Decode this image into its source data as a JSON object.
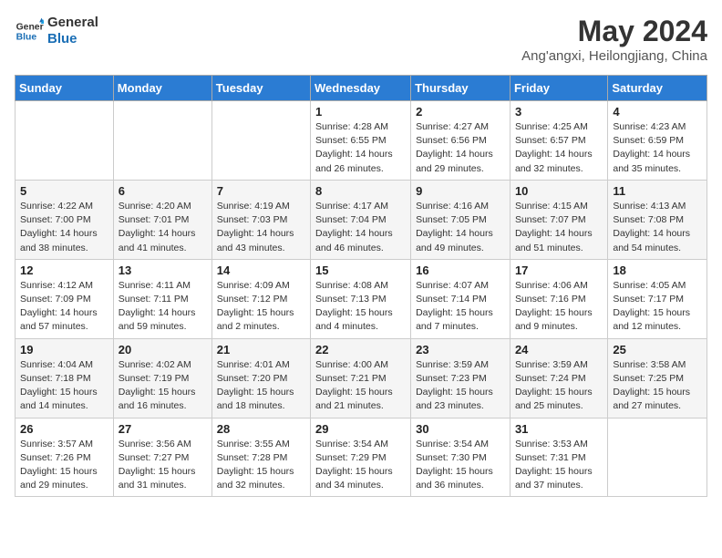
{
  "header": {
    "logo_line1": "General",
    "logo_line2": "Blue",
    "title": "May 2024",
    "subtitle": "Ang'angxi, Heilongjiang, China"
  },
  "days_of_week": [
    "Sunday",
    "Monday",
    "Tuesday",
    "Wednesday",
    "Thursday",
    "Friday",
    "Saturday"
  ],
  "weeks": [
    [
      {
        "day": "",
        "info": ""
      },
      {
        "day": "",
        "info": ""
      },
      {
        "day": "",
        "info": ""
      },
      {
        "day": "1",
        "info": "Sunrise: 4:28 AM\nSunset: 6:55 PM\nDaylight: 14 hours and 26 minutes."
      },
      {
        "day": "2",
        "info": "Sunrise: 4:27 AM\nSunset: 6:56 PM\nDaylight: 14 hours and 29 minutes."
      },
      {
        "day": "3",
        "info": "Sunrise: 4:25 AM\nSunset: 6:57 PM\nDaylight: 14 hours and 32 minutes."
      },
      {
        "day": "4",
        "info": "Sunrise: 4:23 AM\nSunset: 6:59 PM\nDaylight: 14 hours and 35 minutes."
      }
    ],
    [
      {
        "day": "5",
        "info": "Sunrise: 4:22 AM\nSunset: 7:00 PM\nDaylight: 14 hours and 38 minutes."
      },
      {
        "day": "6",
        "info": "Sunrise: 4:20 AM\nSunset: 7:01 PM\nDaylight: 14 hours and 41 minutes."
      },
      {
        "day": "7",
        "info": "Sunrise: 4:19 AM\nSunset: 7:03 PM\nDaylight: 14 hours and 43 minutes."
      },
      {
        "day": "8",
        "info": "Sunrise: 4:17 AM\nSunset: 7:04 PM\nDaylight: 14 hours and 46 minutes."
      },
      {
        "day": "9",
        "info": "Sunrise: 4:16 AM\nSunset: 7:05 PM\nDaylight: 14 hours and 49 minutes."
      },
      {
        "day": "10",
        "info": "Sunrise: 4:15 AM\nSunset: 7:07 PM\nDaylight: 14 hours and 51 minutes."
      },
      {
        "day": "11",
        "info": "Sunrise: 4:13 AM\nSunset: 7:08 PM\nDaylight: 14 hours and 54 minutes."
      }
    ],
    [
      {
        "day": "12",
        "info": "Sunrise: 4:12 AM\nSunset: 7:09 PM\nDaylight: 14 hours and 57 minutes."
      },
      {
        "day": "13",
        "info": "Sunrise: 4:11 AM\nSunset: 7:11 PM\nDaylight: 14 hours and 59 minutes."
      },
      {
        "day": "14",
        "info": "Sunrise: 4:09 AM\nSunset: 7:12 PM\nDaylight: 15 hours and 2 minutes."
      },
      {
        "day": "15",
        "info": "Sunrise: 4:08 AM\nSunset: 7:13 PM\nDaylight: 15 hours and 4 minutes."
      },
      {
        "day": "16",
        "info": "Sunrise: 4:07 AM\nSunset: 7:14 PM\nDaylight: 15 hours and 7 minutes."
      },
      {
        "day": "17",
        "info": "Sunrise: 4:06 AM\nSunset: 7:16 PM\nDaylight: 15 hours and 9 minutes."
      },
      {
        "day": "18",
        "info": "Sunrise: 4:05 AM\nSunset: 7:17 PM\nDaylight: 15 hours and 12 minutes."
      }
    ],
    [
      {
        "day": "19",
        "info": "Sunrise: 4:04 AM\nSunset: 7:18 PM\nDaylight: 15 hours and 14 minutes."
      },
      {
        "day": "20",
        "info": "Sunrise: 4:02 AM\nSunset: 7:19 PM\nDaylight: 15 hours and 16 minutes."
      },
      {
        "day": "21",
        "info": "Sunrise: 4:01 AM\nSunset: 7:20 PM\nDaylight: 15 hours and 18 minutes."
      },
      {
        "day": "22",
        "info": "Sunrise: 4:00 AM\nSunset: 7:21 PM\nDaylight: 15 hours and 21 minutes."
      },
      {
        "day": "23",
        "info": "Sunrise: 3:59 AM\nSunset: 7:23 PM\nDaylight: 15 hours and 23 minutes."
      },
      {
        "day": "24",
        "info": "Sunrise: 3:59 AM\nSunset: 7:24 PM\nDaylight: 15 hours and 25 minutes."
      },
      {
        "day": "25",
        "info": "Sunrise: 3:58 AM\nSunset: 7:25 PM\nDaylight: 15 hours and 27 minutes."
      }
    ],
    [
      {
        "day": "26",
        "info": "Sunrise: 3:57 AM\nSunset: 7:26 PM\nDaylight: 15 hours and 29 minutes."
      },
      {
        "day": "27",
        "info": "Sunrise: 3:56 AM\nSunset: 7:27 PM\nDaylight: 15 hours and 31 minutes."
      },
      {
        "day": "28",
        "info": "Sunrise: 3:55 AM\nSunset: 7:28 PM\nDaylight: 15 hours and 32 minutes."
      },
      {
        "day": "29",
        "info": "Sunrise: 3:54 AM\nSunset: 7:29 PM\nDaylight: 15 hours and 34 minutes."
      },
      {
        "day": "30",
        "info": "Sunrise: 3:54 AM\nSunset: 7:30 PM\nDaylight: 15 hours and 36 minutes."
      },
      {
        "day": "31",
        "info": "Sunrise: 3:53 AM\nSunset: 7:31 PM\nDaylight: 15 hours and 37 minutes."
      },
      {
        "day": "",
        "info": ""
      }
    ]
  ]
}
